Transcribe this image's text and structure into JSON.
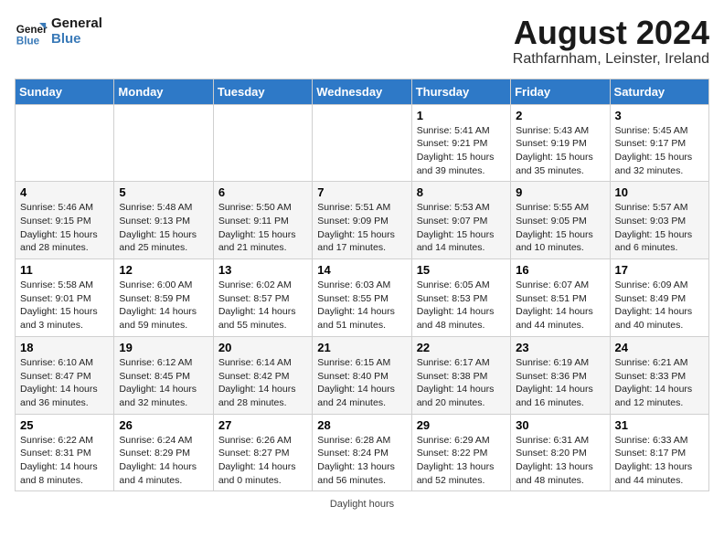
{
  "header": {
    "logo_line1": "General",
    "logo_line2": "Blue",
    "main_title": "August 2024",
    "subtitle": "Rathfarnham, Leinster, Ireland"
  },
  "columns": [
    "Sunday",
    "Monday",
    "Tuesday",
    "Wednesday",
    "Thursday",
    "Friday",
    "Saturday"
  ],
  "weeks": [
    [
      {
        "day": "",
        "info": ""
      },
      {
        "day": "",
        "info": ""
      },
      {
        "day": "",
        "info": ""
      },
      {
        "day": "",
        "info": ""
      },
      {
        "day": "1",
        "info": "Sunrise: 5:41 AM\nSunset: 9:21 PM\nDaylight: 15 hours and 39 minutes."
      },
      {
        "day": "2",
        "info": "Sunrise: 5:43 AM\nSunset: 9:19 PM\nDaylight: 15 hours and 35 minutes."
      },
      {
        "day": "3",
        "info": "Sunrise: 5:45 AM\nSunset: 9:17 PM\nDaylight: 15 hours and 32 minutes."
      }
    ],
    [
      {
        "day": "4",
        "info": "Sunrise: 5:46 AM\nSunset: 9:15 PM\nDaylight: 15 hours and 28 minutes."
      },
      {
        "day": "5",
        "info": "Sunrise: 5:48 AM\nSunset: 9:13 PM\nDaylight: 15 hours and 25 minutes."
      },
      {
        "day": "6",
        "info": "Sunrise: 5:50 AM\nSunset: 9:11 PM\nDaylight: 15 hours and 21 minutes."
      },
      {
        "day": "7",
        "info": "Sunrise: 5:51 AM\nSunset: 9:09 PM\nDaylight: 15 hours and 17 minutes."
      },
      {
        "day": "8",
        "info": "Sunrise: 5:53 AM\nSunset: 9:07 PM\nDaylight: 15 hours and 14 minutes."
      },
      {
        "day": "9",
        "info": "Sunrise: 5:55 AM\nSunset: 9:05 PM\nDaylight: 15 hours and 10 minutes."
      },
      {
        "day": "10",
        "info": "Sunrise: 5:57 AM\nSunset: 9:03 PM\nDaylight: 15 hours and 6 minutes."
      }
    ],
    [
      {
        "day": "11",
        "info": "Sunrise: 5:58 AM\nSunset: 9:01 PM\nDaylight: 15 hours and 3 minutes."
      },
      {
        "day": "12",
        "info": "Sunrise: 6:00 AM\nSunset: 8:59 PM\nDaylight: 14 hours and 59 minutes."
      },
      {
        "day": "13",
        "info": "Sunrise: 6:02 AM\nSunset: 8:57 PM\nDaylight: 14 hours and 55 minutes."
      },
      {
        "day": "14",
        "info": "Sunrise: 6:03 AM\nSunset: 8:55 PM\nDaylight: 14 hours and 51 minutes."
      },
      {
        "day": "15",
        "info": "Sunrise: 6:05 AM\nSunset: 8:53 PM\nDaylight: 14 hours and 48 minutes."
      },
      {
        "day": "16",
        "info": "Sunrise: 6:07 AM\nSunset: 8:51 PM\nDaylight: 14 hours and 44 minutes."
      },
      {
        "day": "17",
        "info": "Sunrise: 6:09 AM\nSunset: 8:49 PM\nDaylight: 14 hours and 40 minutes."
      }
    ],
    [
      {
        "day": "18",
        "info": "Sunrise: 6:10 AM\nSunset: 8:47 PM\nDaylight: 14 hours and 36 minutes."
      },
      {
        "day": "19",
        "info": "Sunrise: 6:12 AM\nSunset: 8:45 PM\nDaylight: 14 hours and 32 minutes."
      },
      {
        "day": "20",
        "info": "Sunrise: 6:14 AM\nSunset: 8:42 PM\nDaylight: 14 hours and 28 minutes."
      },
      {
        "day": "21",
        "info": "Sunrise: 6:15 AM\nSunset: 8:40 PM\nDaylight: 14 hours and 24 minutes."
      },
      {
        "day": "22",
        "info": "Sunrise: 6:17 AM\nSunset: 8:38 PM\nDaylight: 14 hours and 20 minutes."
      },
      {
        "day": "23",
        "info": "Sunrise: 6:19 AM\nSunset: 8:36 PM\nDaylight: 14 hours and 16 minutes."
      },
      {
        "day": "24",
        "info": "Sunrise: 6:21 AM\nSunset: 8:33 PM\nDaylight: 14 hours and 12 minutes."
      }
    ],
    [
      {
        "day": "25",
        "info": "Sunrise: 6:22 AM\nSunset: 8:31 PM\nDaylight: 14 hours and 8 minutes."
      },
      {
        "day": "26",
        "info": "Sunrise: 6:24 AM\nSunset: 8:29 PM\nDaylight: 14 hours and 4 minutes."
      },
      {
        "day": "27",
        "info": "Sunrise: 6:26 AM\nSunset: 8:27 PM\nDaylight: 14 hours and 0 minutes."
      },
      {
        "day": "28",
        "info": "Sunrise: 6:28 AM\nSunset: 8:24 PM\nDaylight: 13 hours and 56 minutes."
      },
      {
        "day": "29",
        "info": "Sunrise: 6:29 AM\nSunset: 8:22 PM\nDaylight: 13 hours and 52 minutes."
      },
      {
        "day": "30",
        "info": "Sunrise: 6:31 AM\nSunset: 8:20 PM\nDaylight: 13 hours and 48 minutes."
      },
      {
        "day": "31",
        "info": "Sunrise: 6:33 AM\nSunset: 8:17 PM\nDaylight: 13 hours and 44 minutes."
      }
    ]
  ],
  "footer": {
    "note": "Daylight hours"
  }
}
